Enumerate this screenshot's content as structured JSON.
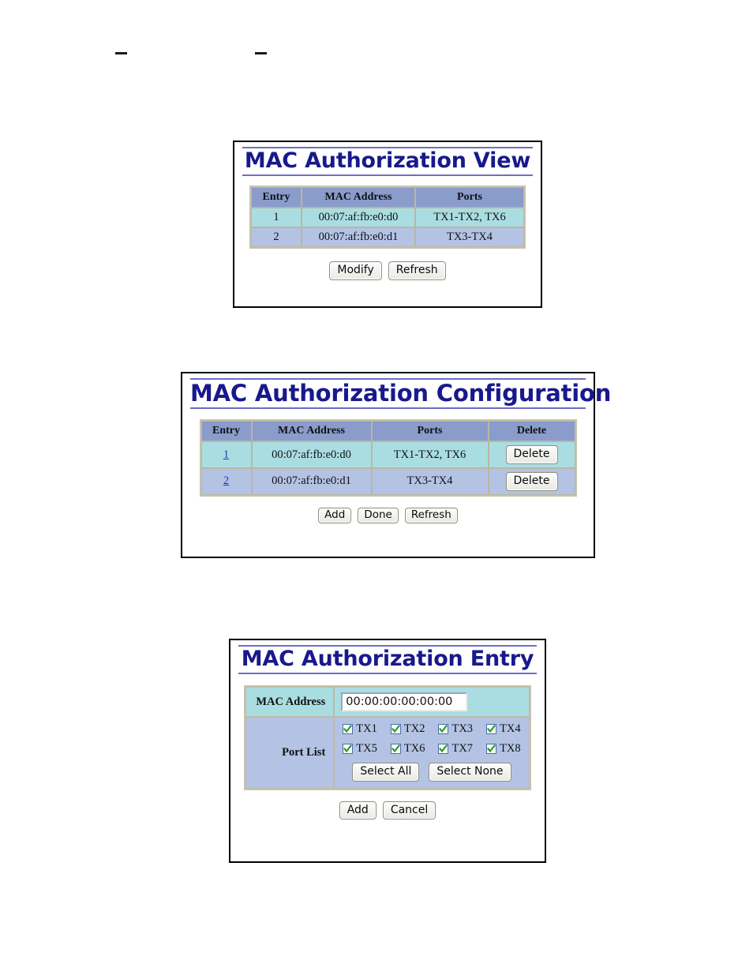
{
  "page": {
    "top_marks": [
      "—",
      "—"
    ]
  },
  "panel_view": {
    "title": "MAC Authorization View",
    "table": {
      "headers": [
        "Entry",
        "MAC Address",
        "Ports"
      ],
      "rows": [
        {
          "entry": "1",
          "mac": "00:07:af:fb:e0:d0",
          "ports": "TX1-TX2, TX6"
        },
        {
          "entry": "2",
          "mac": "00:07:af:fb:e0:d1",
          "ports": "TX3-TX4"
        }
      ]
    },
    "buttons": {
      "modify": "Modify",
      "refresh": "Refresh"
    }
  },
  "panel_config": {
    "title": "MAC Authorization Configuration",
    "table": {
      "headers": [
        "Entry",
        "MAC Address",
        "Ports",
        "Delete"
      ],
      "rows": [
        {
          "entry": "1",
          "mac": "00:07:af:fb:e0:d0",
          "ports": "TX1-TX2, TX6",
          "delete": "Delete"
        },
        {
          "entry": "2",
          "mac": "00:07:af:fb:e0:d1",
          "ports": "TX3-TX4",
          "delete": "Delete"
        }
      ]
    },
    "buttons": {
      "add": "Add",
      "done": "Done",
      "refresh": "Refresh"
    }
  },
  "panel_entry": {
    "title": "MAC Authorization Entry",
    "labels": {
      "mac_address": "MAC Address",
      "port_list": "Port List"
    },
    "mac_input": {
      "value": "00:00:00:00:00:00",
      "placeholder": "00:00:00:00:00:00"
    },
    "ports": [
      {
        "label": "TX1",
        "checked": true
      },
      {
        "label": "TX2",
        "checked": true
      },
      {
        "label": "TX3",
        "checked": true
      },
      {
        "label": "TX4",
        "checked": true
      },
      {
        "label": "TX5",
        "checked": true
      },
      {
        "label": "TX6",
        "checked": true
      },
      {
        "label": "TX7",
        "checked": true
      },
      {
        "label": "TX8",
        "checked": true
      }
    ],
    "buttons": {
      "select_all": "Select All",
      "select_none": "Select None",
      "add": "Add",
      "cancel": "Cancel"
    }
  },
  "colors": {
    "title_text": "#18198c",
    "title_rule": "#6b6fc4",
    "table_header_bg": "#8a9ccc",
    "row_odd_bg": "#aadde2",
    "row_even_bg": "#b4c3e4",
    "table_border": "#c7c3ad",
    "link": "#2b36b5",
    "check_green": "#2e9b2e",
    "panel_border": "#000000"
  }
}
